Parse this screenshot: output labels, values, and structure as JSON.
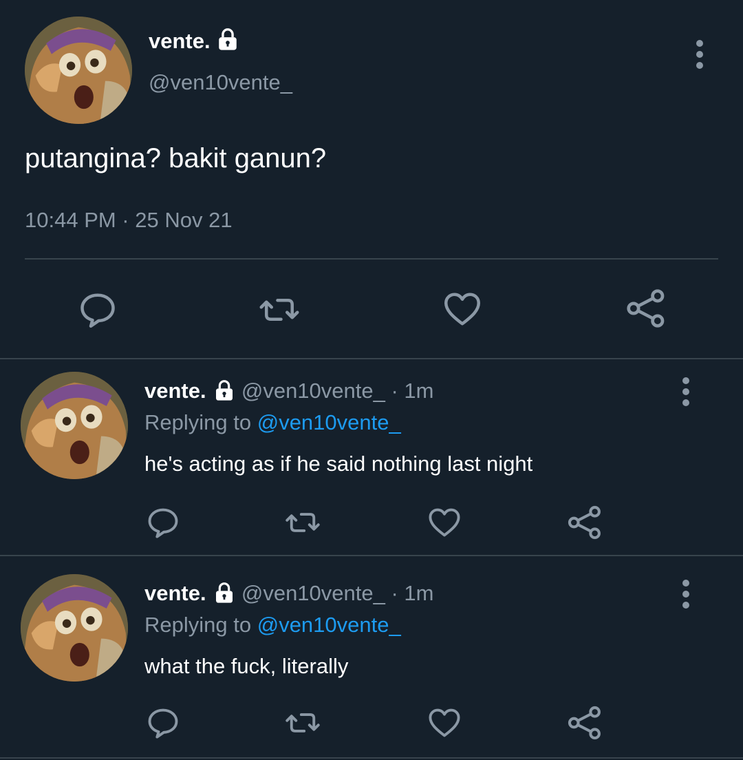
{
  "main_tweet": {
    "display_name": "vente.",
    "handle": "@ven10vente_",
    "text": "putangina? bakit ganun?",
    "timestamp": "10:44 PM · 25 Nov 21"
  },
  "replies": [
    {
      "display_name": "vente.",
      "handle": "@ven10vente_",
      "time": "· 1m",
      "replying_prefix": "Replying to",
      "replying_to": "@ven10vente_",
      "text": "he's acting as if he said nothing last night"
    },
    {
      "display_name": "vente.",
      "handle": "@ven10vente_",
      "time": "· 1m",
      "replying_prefix": "Replying to",
      "replying_to": "@ven10vente_",
      "text": "what the fuck, literally"
    }
  ],
  "icons": {
    "reply": "speech-bubble-icon",
    "retweet": "retweet-icon",
    "like": "heart-icon",
    "share": "share-icon",
    "more": "vertical-dots-icon",
    "protected": "lock-icon"
  },
  "colors": {
    "background": "#15202b",
    "text": "#ffffff",
    "muted": "#8b98a5",
    "link": "#1d9bf0",
    "divider": "#38444d"
  }
}
